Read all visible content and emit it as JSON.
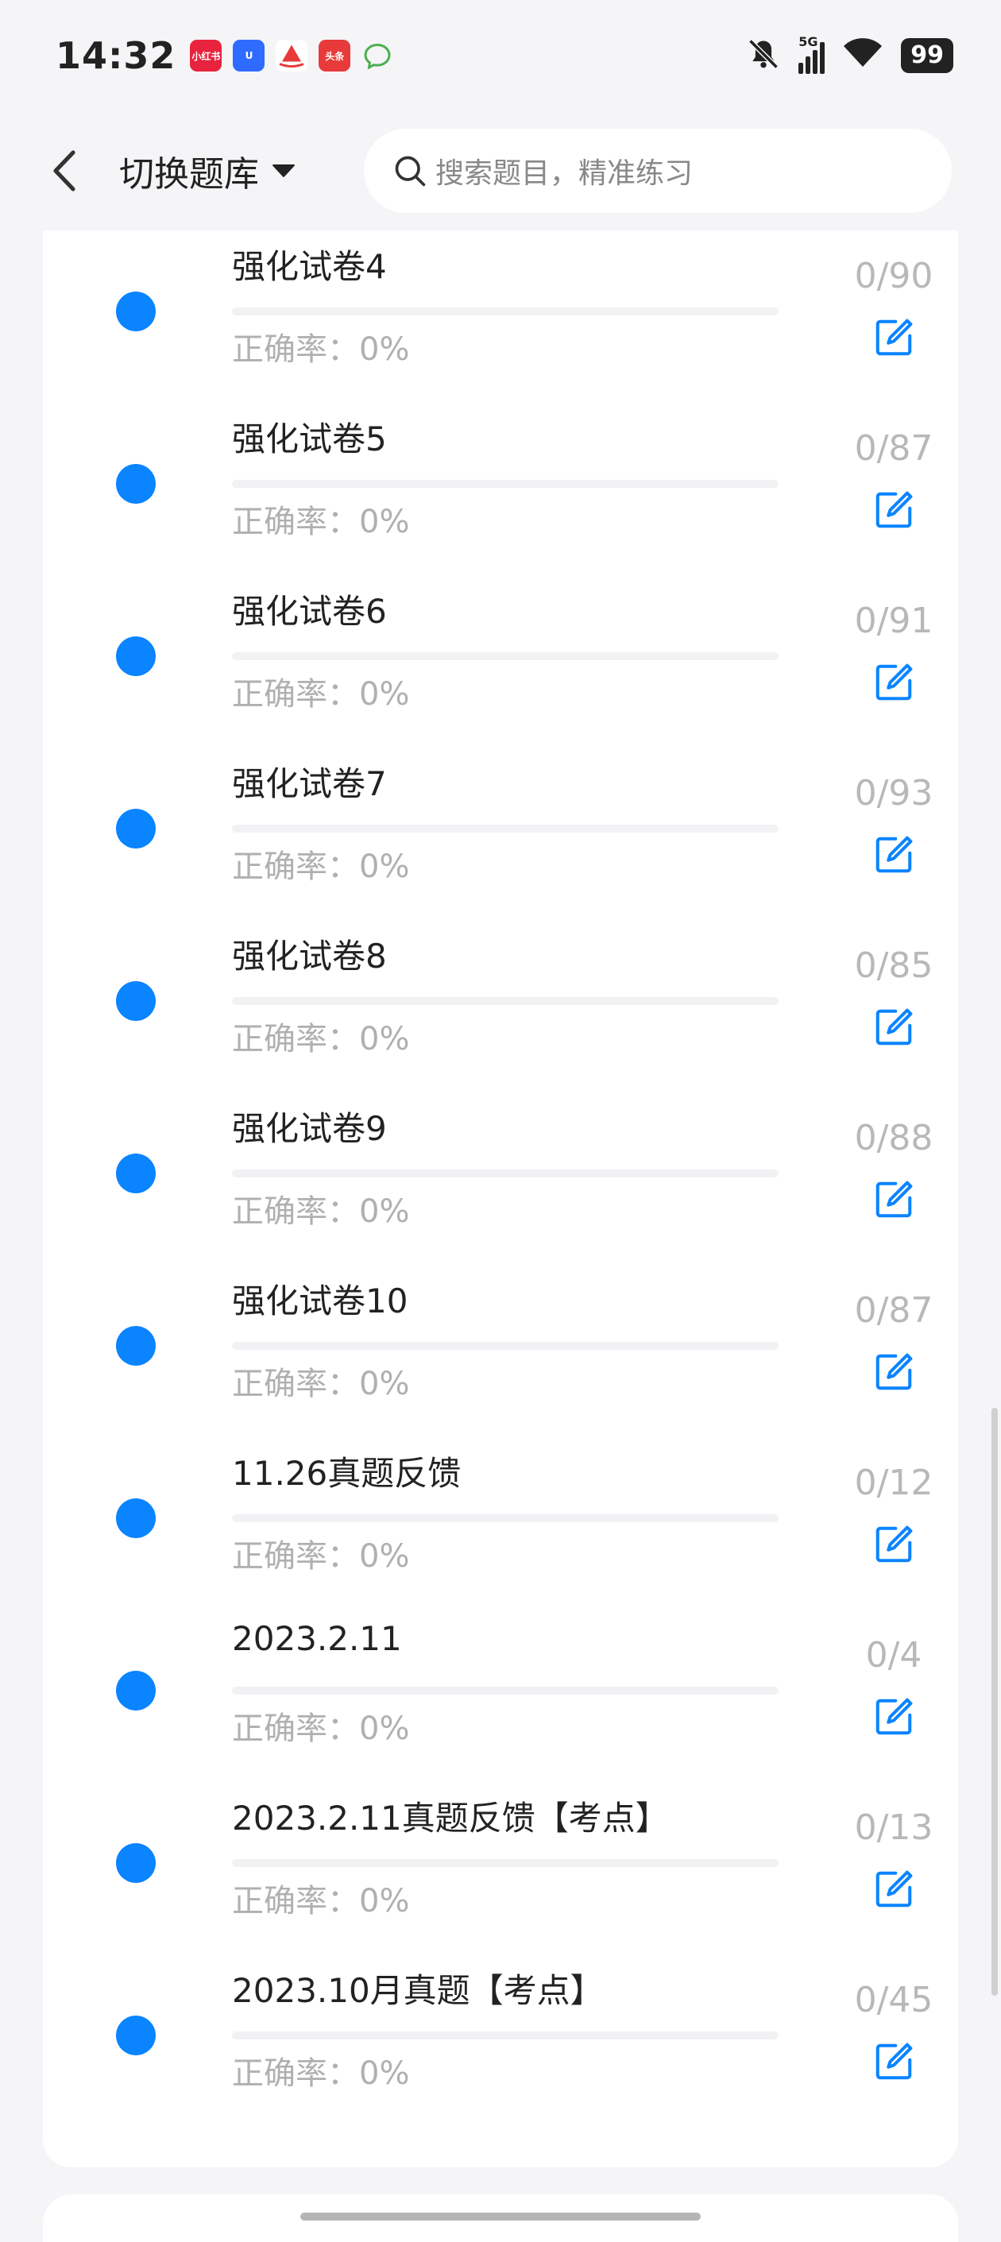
{
  "status_bar": {
    "time": "14:32",
    "apps": [
      {
        "icon": "xiaohongshu-icon",
        "text": "小红书",
        "color": "#e8233d"
      },
      {
        "icon": "u-app-icon",
        "text": "U",
        "color": "#2f6bff"
      },
      {
        "icon": "boat-app-icon",
        "text": "",
        "color": "#e83a3a"
      },
      {
        "icon": "toutiao-icon",
        "text": "头条",
        "color": "#e83a3a"
      },
      {
        "icon": "chat-bubble-icon",
        "text": "",
        "color": "#4caf50"
      }
    ],
    "network_label": "5G",
    "battery": "99"
  },
  "nav": {
    "bank_switch_label": "切换题库",
    "search_placeholder": "搜索题目，精准练习"
  },
  "theme": {
    "accent": "#0a84ff",
    "muted_text": "#b0b0b0"
  },
  "items": [
    {
      "title": "强化试卷4",
      "accuracy": "正确率：0%",
      "count": "0/90",
      "progress": 0
    },
    {
      "title": "强化试卷5",
      "accuracy": "正确率：0%",
      "count": "0/87",
      "progress": 0
    },
    {
      "title": "强化试卷6",
      "accuracy": "正确率：0%",
      "count": "0/91",
      "progress": 0
    },
    {
      "title": "强化试卷7",
      "accuracy": "正确率：0%",
      "count": "0/93",
      "progress": 0
    },
    {
      "title": "强化试卷8",
      "accuracy": "正确率：0%",
      "count": "0/85",
      "progress": 0
    },
    {
      "title": "强化试卷9",
      "accuracy": "正确率：0%",
      "count": "0/88",
      "progress": 0
    },
    {
      "title": "强化试卷10",
      "accuracy": "正确率：0%",
      "count": "0/87",
      "progress": 0
    },
    {
      "title": "11.26真题反馈",
      "accuracy": "正确率：0%",
      "count": "0/12",
      "progress": 0
    },
    {
      "title": "2023.2.11",
      "accuracy": "正确率：0%",
      "count": "0/4",
      "progress": 0
    },
    {
      "title": "2023.2.11真题反馈【考点】",
      "accuracy": "正确率：0%",
      "count": "0/13",
      "progress": 0
    },
    {
      "title": "2023.10月真题【考点】",
      "accuracy": "正确率：0%",
      "count": "0/45",
      "progress": 0
    }
  ]
}
